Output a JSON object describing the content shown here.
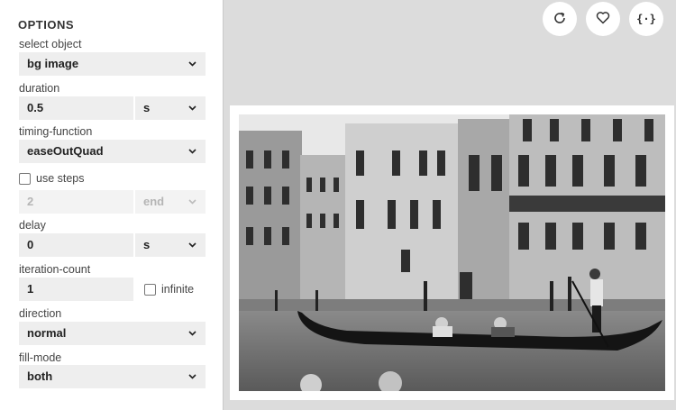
{
  "panel": {
    "title": "OPTIONS",
    "select_object": {
      "label": "select object",
      "value": "bg image"
    },
    "duration": {
      "label": "duration",
      "value": "0.5",
      "unit": "s"
    },
    "timing_function": {
      "label": "timing-function",
      "value": "easeOutQuad"
    },
    "use_steps": {
      "label": "use steps",
      "checked": false,
      "steps_value": "2",
      "steps_position": "end"
    },
    "delay": {
      "label": "delay",
      "value": "0",
      "unit": "s"
    },
    "iteration_count": {
      "label": "iteration-count",
      "value": "1",
      "infinite_label": "infinite",
      "infinite_checked": false
    },
    "direction": {
      "label": "direction",
      "value": "normal"
    },
    "fill_mode": {
      "label": "fill-mode",
      "value": "both"
    }
  },
  "toolbar": {
    "icons": [
      "refresh-icon",
      "heart-icon",
      "code-icon"
    ],
    "code_glyph": "{·}"
  },
  "preview": {
    "image": "black-and-white photo of a gondola on a Venice canal"
  }
}
